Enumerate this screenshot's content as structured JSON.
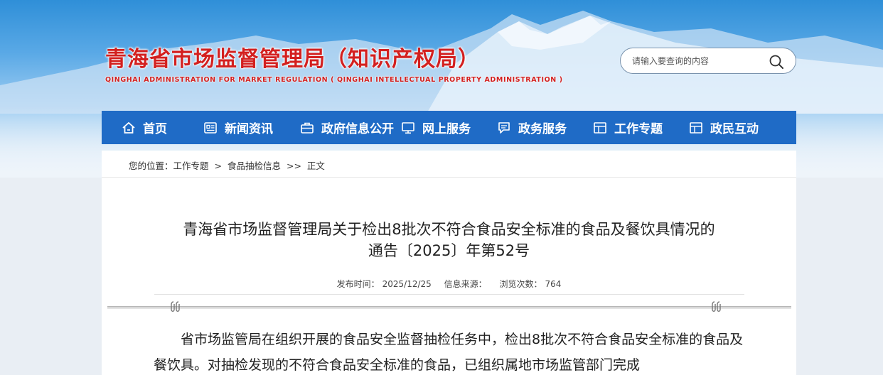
{
  "header": {
    "title": "青海省市场监督管理局（知识产权局）",
    "subtitle": "QINGHAI ADMINISTRATION FOR MARKET REGULATION ( QINGHAI INTELLECTUAL PROPERTY ADMINISTRATION )",
    "search": {
      "placeholder": "请输入要查询的内容",
      "icon": "search-icon"
    }
  },
  "nav": {
    "items": [
      {
        "label": "首页",
        "icon": "home-icon"
      },
      {
        "label": "新闻资讯",
        "icon": "news-icon"
      },
      {
        "label": "政府信息公开",
        "icon": "briefcase-icon"
      },
      {
        "label": "网上服务",
        "icon": "monitor-icon"
      },
      {
        "label": "政务服务",
        "icon": "chat-icon"
      },
      {
        "label": "工作专题",
        "icon": "layout-icon"
      },
      {
        "label": "政民互动",
        "icon": "layout-icon"
      }
    ]
  },
  "breadcrumb": {
    "prefix": "您的位置：",
    "items": [
      "工作专题",
      "食品抽检信息",
      "正文"
    ],
    "sep1": ">",
    "sep2": ">>"
  },
  "article": {
    "title_line1": "青海省市场监督管理局关于检出8批次不符合食品安全标准的食品及餐饮具情况的",
    "title_line2": "通告〔2025〕年第52号",
    "meta": {
      "publish_label": "发布时间：",
      "publish_date": "2025/12/25",
      "source_label": "信息来源：",
      "views_label": "浏览次数：",
      "views": "764"
    },
    "body": "省市场监管局在组织开展的食品安全监督抽检任务中，检出8批次不符合食品安全标准的食品及餐饮具。对抽检发现的不符合食品安全标准的食品，已组织属地市场监管部门完成"
  },
  "colors": {
    "brand_red": "#d3201f",
    "nav_blue": "#1f6bc6"
  }
}
